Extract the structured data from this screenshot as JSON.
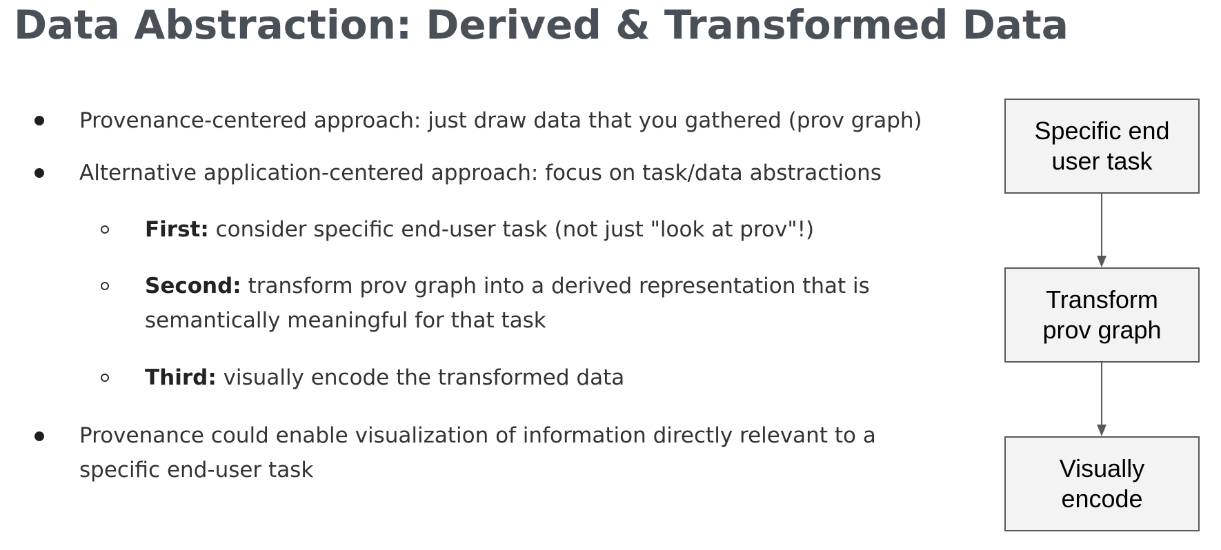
{
  "title": "Data Abstraction: Derived & Transformed Data",
  "bullets": [
    {
      "text": "Provenance-centered approach: just draw data that you gathered (prov graph)"
    },
    {
      "text": "Alternative application-centered approach:  focus on task/data abstractions"
    },
    {
      "bold": "First:",
      "text": " consider specific end-user task (not just \"look at prov\"!)"
    },
    {
      "bold": "Second:",
      "text": " transform prov graph into a derived representation that is",
      "text2": "semantically meaningful for that task"
    },
    {
      "bold": "Third:",
      "text": " visually encode the transformed data"
    },
    {
      "text": "Provenance could enable visualization of information directly relevant to a",
      "text2": "specific end-user task"
    }
  ],
  "flow": {
    "boxes": [
      "Specific end\nuser task",
      "Transform\nprov graph",
      "Visually\nencode"
    ],
    "box_fill": "#f3f3f3",
    "border_color": "#595959"
  }
}
